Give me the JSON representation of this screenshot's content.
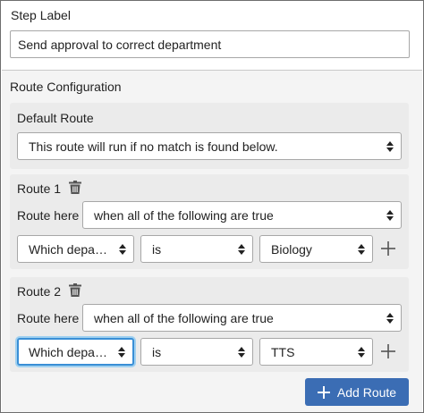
{
  "step_label": {
    "title": "Step Label",
    "value": "Send approval to correct department"
  },
  "route_configuration": {
    "title": "Route Configuration",
    "default_route": {
      "title": "Default Route",
      "selected": "This route will run if no match is found below."
    },
    "routes": [
      {
        "title": "Route 1",
        "route_here_label": "Route here",
        "match_selected": "when all of the following are true",
        "condition": {
          "field": "Which depart…",
          "operator": "is",
          "value": "Biology"
        }
      },
      {
        "title": "Route 2",
        "route_here_label": "Route here",
        "match_selected": "when all of the following are true",
        "condition": {
          "field": "Which depart…",
          "operator": "is",
          "value": "TTS"
        }
      }
    ],
    "add_route_label": "Add Route"
  },
  "colors": {
    "primary_button": "#3b6db4",
    "focus_ring": "#3a8fd6",
    "panel_bg": "#ebebeb",
    "section_bg": "#f4f4f4"
  },
  "icons": [
    "trash-icon",
    "plus-icon",
    "select-caret-icon"
  ]
}
